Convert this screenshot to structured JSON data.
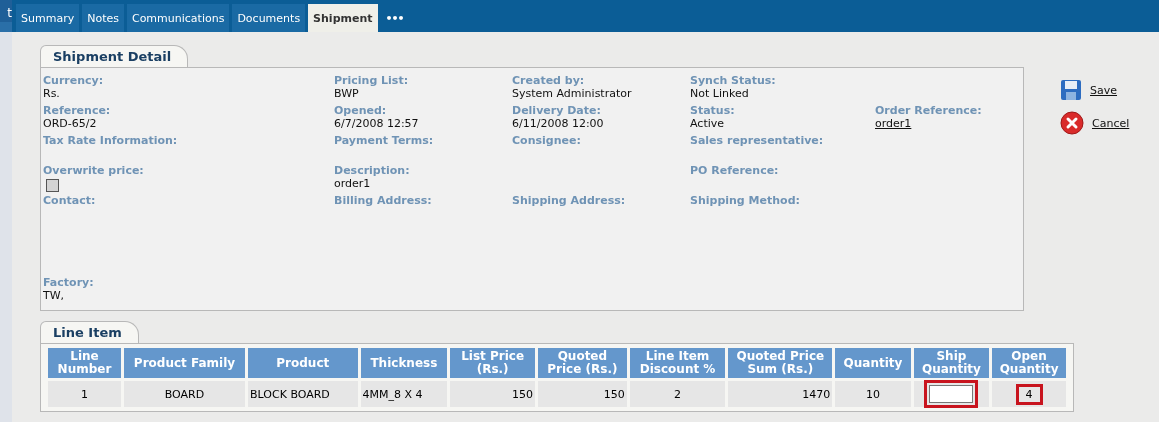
{
  "side_tab": "t",
  "tabs": [
    {
      "label": "Summary",
      "selected": false
    },
    {
      "label": "Notes",
      "selected": false
    },
    {
      "label": "Communications",
      "selected": false
    },
    {
      "label": "Documents",
      "selected": false
    },
    {
      "label": "Shipment",
      "selected": true
    },
    {
      "label": "•••",
      "selected": false
    }
  ],
  "detail": {
    "title": "Shipment Detail",
    "rows": [
      [
        {
          "label": "Currency:",
          "value": "Rs.",
          "kind": "text"
        },
        {
          "label": "Pricing List:",
          "value": "BWP",
          "kind": "text"
        },
        {
          "label": "Created by:",
          "value": "System Administrator",
          "kind": "text"
        },
        {
          "label": "Synch Status:",
          "value": "Not Linked",
          "kind": "text"
        },
        null
      ],
      [
        {
          "label": "Reference:",
          "value": "ORD-65/2",
          "kind": "text"
        },
        {
          "label": "Opened:",
          "value": "6/7/2008 12:57",
          "kind": "text"
        },
        {
          "label": "Delivery Date:",
          "value": "6/11/2008 12:00",
          "kind": "text"
        },
        {
          "label": "Status:",
          "value": "Active",
          "kind": "text"
        },
        {
          "label": "Order Reference:",
          "value": "order1",
          "kind": "link"
        }
      ],
      [
        {
          "label": "Tax Rate Information:",
          "kind": "text"
        },
        {
          "label": "Payment Terms:",
          "kind": "text"
        },
        {
          "label": "Consignee:",
          "kind": "text"
        },
        {
          "label": "Sales representative:",
          "kind": "text"
        },
        null
      ],
      [
        {
          "label": "Overwrite price:",
          "kind": "checkbox",
          "checked": false,
          "disabled": true
        },
        {
          "label": "Description:",
          "value": "order1",
          "kind": "text"
        },
        null,
        {
          "label": "PO Reference:",
          "kind": "text"
        },
        null
      ],
      [
        {
          "label": "Contact:",
          "kind": "text"
        },
        {
          "label": "Billing Address:",
          "kind": "text"
        },
        {
          "label": "Shipping Address:",
          "kind": "text"
        },
        {
          "label": "Shipping Method:",
          "kind": "text"
        },
        null
      ],
      [
        {
          "label": "Factory:",
          "value": "TW,",
          "kind": "text"
        },
        null,
        null,
        null,
        null
      ]
    ]
  },
  "actions": [
    {
      "label": "Save",
      "kind": "save"
    },
    {
      "label": "Cancel",
      "kind": "cancel"
    }
  ],
  "line_item": {
    "title": "Line Item",
    "columns": [
      "Line Number",
      "Product Family",
      "Product",
      "Thickness",
      "List Price (Rs.)",
      "Quoted Price (Rs.)",
      "Line Item Discount %",
      "Quoted Price Sum (Rs.)",
      "Quantity",
      "Ship Quantity",
      "Open Quantity"
    ],
    "rows": [
      [
        {
          "text": "1",
          "kind": "text",
          "highlighted": false
        },
        {
          "text": "BOARD",
          "kind": "text",
          "highlighted": false
        },
        {
          "text": "BLOCK BOARD",
          "kind": "text",
          "highlighted": false
        },
        {
          "text": "4MM_8 X 4",
          "kind": "text",
          "highlighted": false
        },
        {
          "text": "150",
          "kind": "text",
          "highlighted": false
        },
        {
          "text": "150",
          "kind": "text",
          "highlighted": false
        },
        {
          "text": "2",
          "kind": "text",
          "highlighted": false
        },
        {
          "text": "1470",
          "kind": "text",
          "highlighted": false
        },
        {
          "text": "10",
          "kind": "text",
          "highlighted": false
        },
        {
          "kind": "input",
          "highlighted": true
        },
        {
          "text": "4",
          "kind": "text",
          "highlighted": true
        }
      ]
    ]
  }
}
